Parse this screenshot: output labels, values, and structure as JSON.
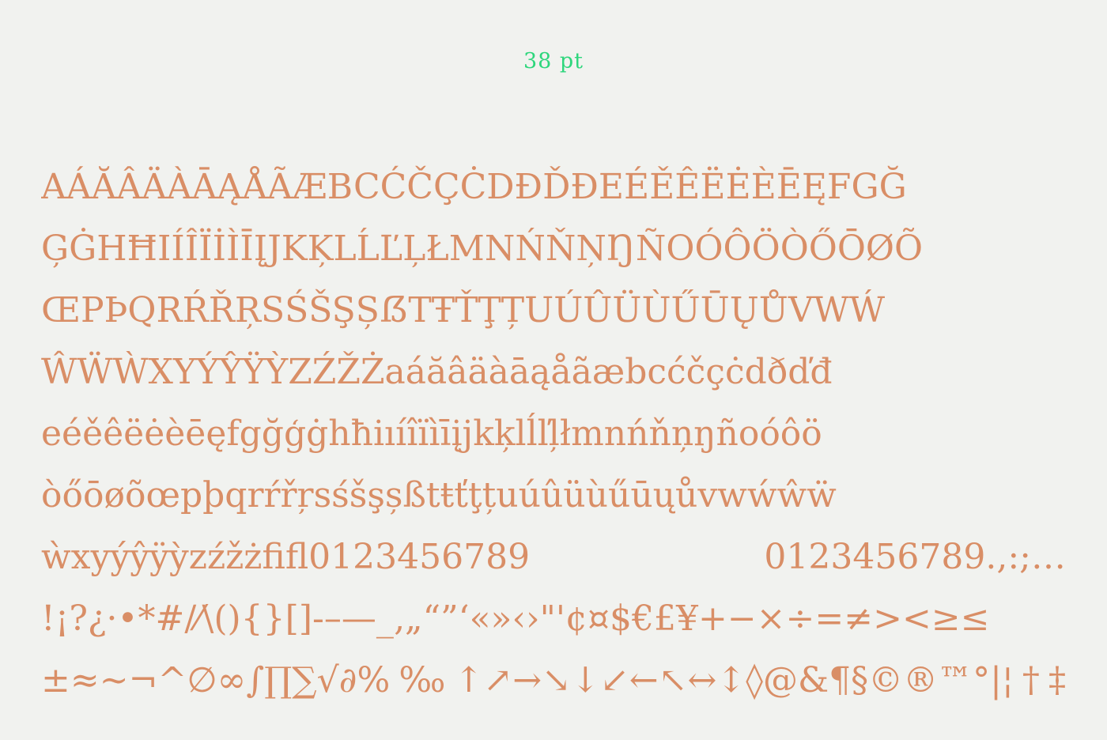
{
  "header": {
    "size_label": "38 pt"
  },
  "glyph_rows": [
    "AÁĂÂÄÀĀĄÅÃÆBCĆČÇĊDĐĎĐEÉĚÊËĖÈĒĘFGĞ",
    "ĢĠHĦIÍÎÏİÌĪĮJKĶLĹĽĻŁMNŃŇŅŊÑOÓÔÖÒŐŌØÕ",
    "ŒPÞQRŔŘŖSŚŠŞȘẞTŦŤŢȚUÚÛÜÙŰŪŲŮVWẂ",
    "ŴẄẀXYÝŶŸỲZŹŽŻaáăâäàāąåãæbcćčçċdðďđ",
    "eéěêëėèēęfgğģġhħiıíîïìīįjkķlĺľļłmnńňņŋñoóôö",
    "òőōøõœpþqrŕřŗsśšşșßtŧťţțuúûüùűūųůvwẃŵẅ",
    "ẁxyýŷÿỳzźžżﬁﬂ0123456789 0123456789.,:;…",
    "!¡?¿·•*#/⁄\\(){}[]-–—_‚„“”‘«»‹›\"'¢¤$€£¥+−×÷=≠><≥≤",
    "±≈~¬^∅∞∫∏∑√∂%‰↑↗→↘↓↙←↖↔↕◊@&¶§©®™°|¦†‡"
  ],
  "colors": {
    "background": "#f1f2ef",
    "glyph": "#d98e66",
    "label": "#2ed67c"
  }
}
